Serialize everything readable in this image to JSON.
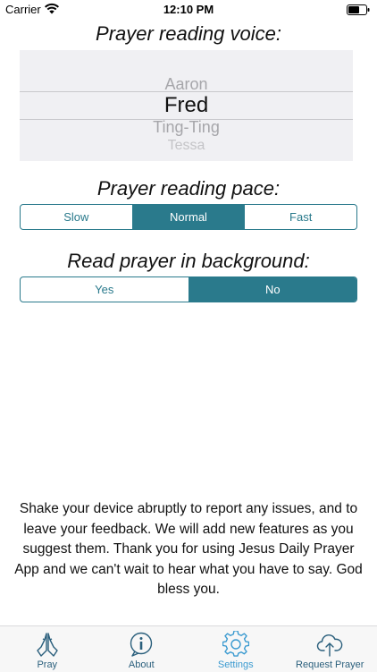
{
  "status_bar": {
    "carrier": "Carrier",
    "time": "12:10 PM"
  },
  "voice": {
    "title": "Prayer reading voice:",
    "options": [
      "Aaron",
      "Fred",
      "Ting-Ting",
      "Tessa"
    ],
    "selected": "Fred"
  },
  "pace": {
    "title": "Prayer reading pace:",
    "segments": [
      "Slow",
      "Normal",
      "Fast"
    ],
    "selected": "Normal"
  },
  "background": {
    "title": "Read prayer in background:",
    "segments": [
      "Yes",
      "No"
    ],
    "selected": "No"
  },
  "note": "Shake your device abruptly to report any issues, and to leave your feedback. We will add new features as you suggest them. Thank you for using Jesus Daily Prayer App and we can't wait to hear what you have to say. God bless you.",
  "tabs": [
    {
      "label": "Pray",
      "icon": "praying-hands-icon"
    },
    {
      "label": "About",
      "icon": "info-bubble-icon"
    },
    {
      "label": "Settings",
      "icon": "gear-icon"
    },
    {
      "label": "Request Prayer",
      "icon": "cloud-upload-icon"
    }
  ],
  "active_tab": "Settings",
  "colors": {
    "accent": "#2a7a8c",
    "tab_inactive": "#2a5f7c",
    "tab_active": "#3a9ad0",
    "picker_bg": "#f0f0f3"
  }
}
